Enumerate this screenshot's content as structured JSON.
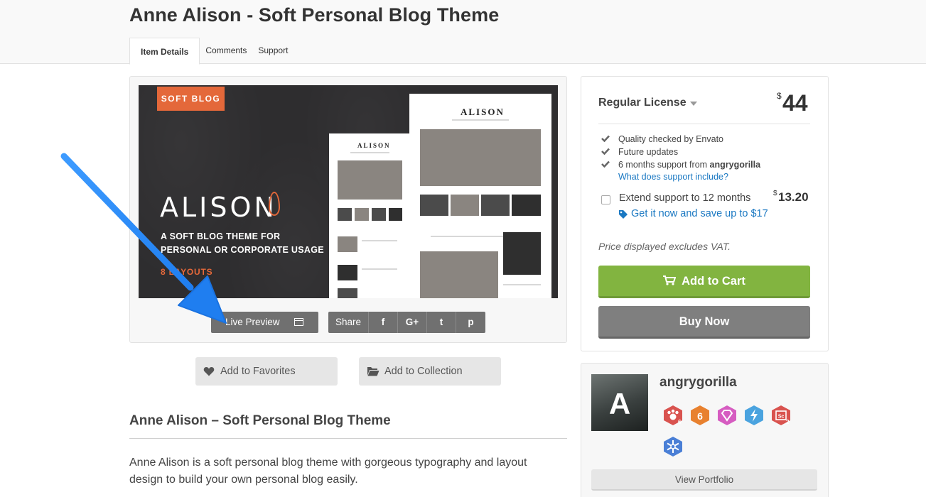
{
  "page": {
    "title": "Anne Alison - Soft Personal Blog Theme"
  },
  "tabs": [
    {
      "label": "Item Details",
      "active": true
    },
    {
      "label": "Comments",
      "active": false
    },
    {
      "label": "Support",
      "active": false
    }
  ],
  "preview": {
    "badge": "SOFT BLOG",
    "logo": "ALISON",
    "tagline_line1": "A SOFT BLOG THEME FOR",
    "tagline_line2": "PERSONAL OR CORPORATE USAGE",
    "layouts_text": "8 LAYOUTS",
    "mock_logo": "ALISON",
    "accent_color": "#e4683a"
  },
  "preview_actions": {
    "live_preview_label": "Live Preview",
    "share_label": "Share",
    "share_icons": [
      "facebook-icon",
      "google-plus-icon",
      "twitter-icon",
      "pinterest-icon"
    ],
    "share_glyphs": [
      "f",
      "G+",
      "t",
      "p"
    ]
  },
  "item_actions": {
    "favorites_label": "Add to Favorites",
    "collection_label": "Add to Collection"
  },
  "description": {
    "title": "Anne Alison – Soft Personal Blog Theme",
    "body": "Anne Alison is a soft personal blog theme with gorgeous typography and layout design to build your own personal blog easily."
  },
  "license": {
    "name": "Regular License",
    "currency": "$",
    "price": "44",
    "features": [
      {
        "text": "Quality checked by Envato"
      },
      {
        "text": "Future updates"
      },
      {
        "text_prefix": "6 months support from ",
        "text_bold": "angrygorilla"
      }
    ],
    "support_link": "What does support include?",
    "extend_label": "Extend support to 12 months",
    "extend_currency": "$",
    "extend_price": "13.20",
    "extend_checked": false,
    "save_link": "Get it now and save up to $17",
    "vat_note": "Price displayed excludes VAT.",
    "add_to_cart_label": "Add to Cart",
    "buy_now_label": "Buy Now",
    "colors": {
      "cart": "#82b440",
      "buy": "#7f7f7f",
      "link": "#1a78c2"
    }
  },
  "author": {
    "name": "angrygorilla",
    "avatar_letter": "A",
    "badges": [
      {
        "name": "paw-badge",
        "color": "#d9534f",
        "count": "6"
      },
      {
        "name": "six-badge",
        "color": "#e8812f",
        "glyph": "6"
      },
      {
        "name": "diamond-badge",
        "color": "#d65cc1"
      },
      {
        "name": "bolt-badge",
        "color": "#4aa3df"
      },
      {
        "name": "chip-badge",
        "color": "#d9534f",
        "glyph": "Sc",
        "count": "2"
      },
      {
        "name": "snowflake-badge",
        "color": "#4a7fd6"
      }
    ],
    "portfolio_label": "View Portfolio"
  }
}
